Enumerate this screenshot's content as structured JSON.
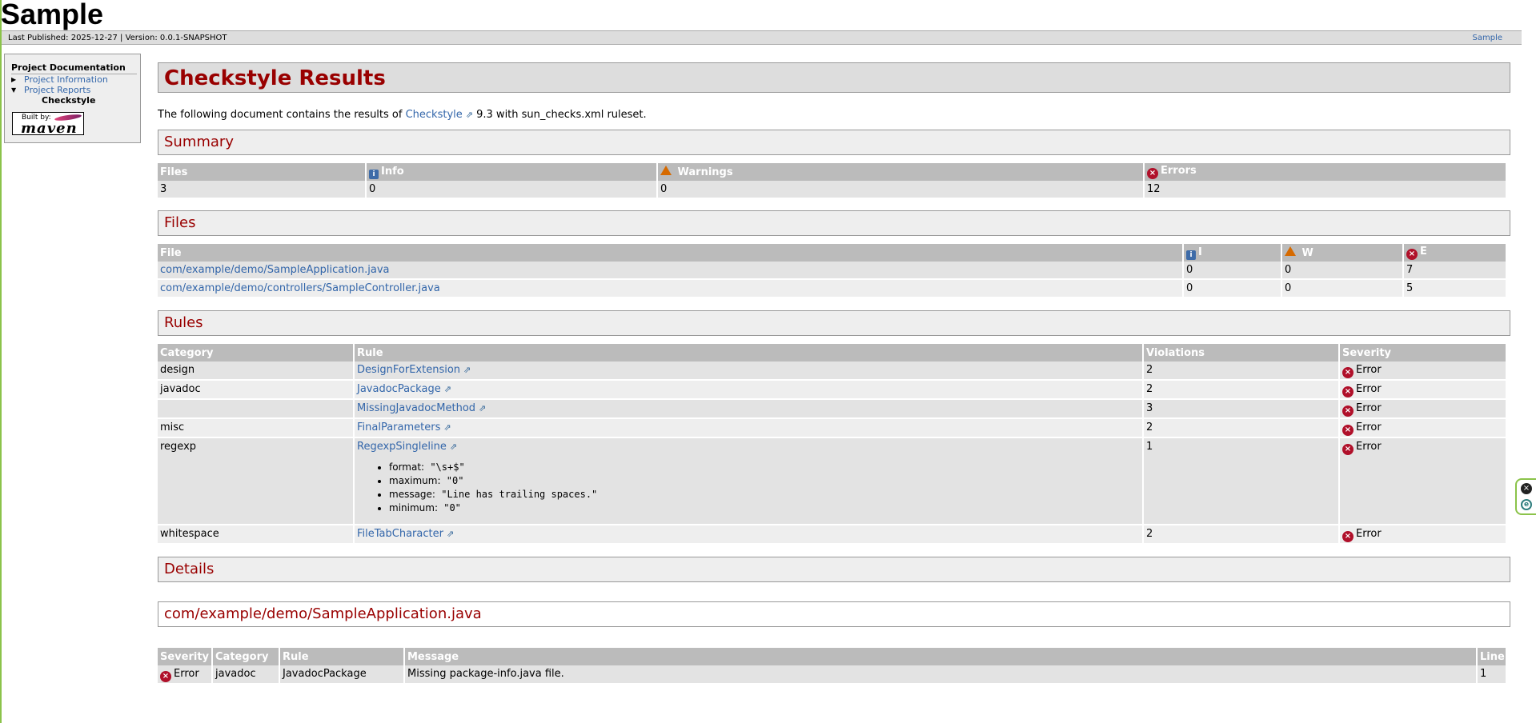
{
  "site": {
    "title": "Sample"
  },
  "banner": {
    "last_published_label": "Last Published: 2025-12-27",
    "separator": "|",
    "version_label": "Version: 0.0.1-SNAPSHOT",
    "right_link": "Sample"
  },
  "nav": {
    "heading": "Project Documentation",
    "items": [
      {
        "label": "Project Information",
        "expanded": false
      },
      {
        "label": "Project Reports",
        "expanded": true
      }
    ],
    "sub_item": "Checkstyle",
    "built_by": {
      "top": "Built by:",
      "brand": "maven"
    }
  },
  "page": {
    "title": "Checkstyle Results",
    "intro_before": "The following document contains the results of",
    "intro_link": "Checkstyle",
    "intro_after": "9.3 with sun_checks.xml ruleset."
  },
  "summary": {
    "heading": "Summary",
    "headers": {
      "files": "Files",
      "info": "Info",
      "warnings": "Warnings",
      "errors": "Errors"
    },
    "row": {
      "files": "3",
      "info": "0",
      "warnings": "0",
      "errors": "12"
    }
  },
  "files": {
    "heading": "Files",
    "headers": {
      "file": "File",
      "i": "I",
      "w": "W",
      "e": "E"
    },
    "rows": [
      {
        "file": "com/example/demo/SampleApplication.java",
        "i": "0",
        "w": "0",
        "e": "7"
      },
      {
        "file": "com/example/demo/controllers/SampleController.java",
        "i": "0",
        "w": "0",
        "e": "5"
      }
    ]
  },
  "rules": {
    "heading": "Rules",
    "headers": {
      "category": "Category",
      "rule": "Rule",
      "violations": "Violations",
      "severity": "Severity"
    },
    "rows": [
      {
        "category": "design",
        "rule": "DesignForExtension",
        "violations": "2",
        "severity": "Error"
      },
      {
        "category": "javadoc",
        "rule": "JavadocPackage",
        "violations": "2",
        "severity": "Error"
      },
      {
        "category": "",
        "rule": "MissingJavadocMethod",
        "violations": "3",
        "severity": "Error"
      },
      {
        "category": "misc",
        "rule": "FinalParameters",
        "violations": "2",
        "severity": "Error"
      },
      {
        "category": "regexp",
        "rule": "RegexpSingleline",
        "violations": "1",
        "severity": "Error"
      },
      {
        "category": "whitespace",
        "rule": "FileTabCharacter",
        "violations": "2",
        "severity": "Error"
      }
    ],
    "regexp_params": [
      {
        "key": "format:",
        "value": "\"\\s+$\""
      },
      {
        "key": "maximum:",
        "value": "\"0\""
      },
      {
        "key": "message:",
        "value": "\"Line has trailing spaces.\""
      },
      {
        "key": "minimum:",
        "value": "\"0\""
      }
    ]
  },
  "details": {
    "heading": "Details",
    "file_heading": "com/example/demo/SampleApplication.java",
    "headers": {
      "severity": "Severity",
      "category": "Category",
      "rule": "Rule",
      "message": "Message",
      "line": "Line"
    },
    "rows": [
      {
        "severity": "Error",
        "category": "javadoc",
        "rule": "JavadocPackage",
        "message": "Missing package-info.java file.",
        "line": "1"
      }
    ]
  },
  "icons": {
    "info": "info-icon",
    "warning": "warning-icon",
    "error": "error-icon",
    "external": "external-link-icon"
  },
  "colors": {
    "heading_red": "#990000",
    "link_blue": "#3366aa",
    "error_red": "#b0102a",
    "table_header": "#bbbbbb"
  }
}
